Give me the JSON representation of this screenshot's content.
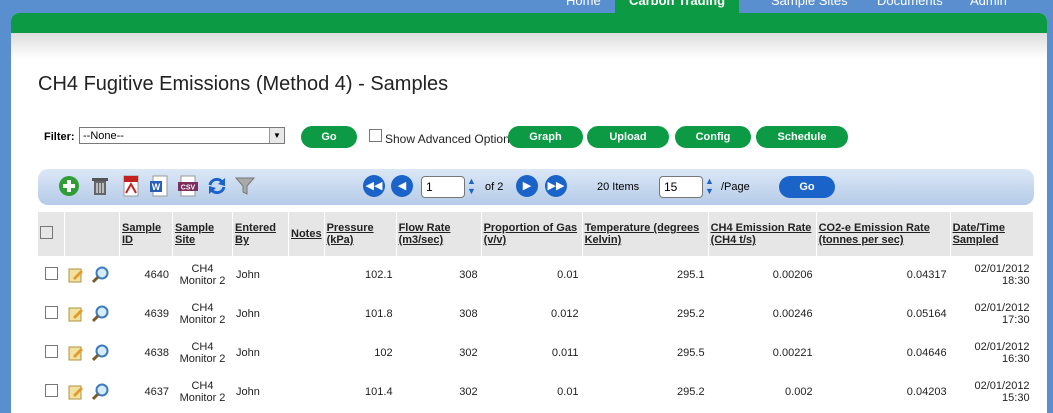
{
  "topnav": {
    "items": [
      "Home",
      "Carbon Trading",
      "Sample Sites",
      "Documents",
      "Admin"
    ],
    "active": "Carbon Trading"
  },
  "page_title": "CH4 Fugitive Emissions (Method 4) - Samples",
  "filter": {
    "label": "Filter:",
    "value": "--None--",
    "go": "Go",
    "show_advanced": "Show Advanced Options"
  },
  "actions": [
    "Graph",
    "Upload",
    "Config",
    "Schedule"
  ],
  "pager": {
    "page": "1",
    "of": "of 2",
    "items": "20 Items",
    "per_page": "15",
    "per_page_label": "/Page",
    "go": "Go"
  },
  "table": {
    "headers": [
      "Sample ID",
      "Sample Site",
      "Entered By",
      "Notes",
      "Pressure (kPa)",
      "Flow Rate (m3/sec)",
      "Proportion of Gas (v/v)",
      "Temperature (degrees Kelvin)",
      "CH4 Emission Rate (CH4 t/s)",
      "CO2-e Emission Rate (tonnes per sec)",
      "Date/Time Sampled"
    ],
    "rows": [
      {
        "id": "4640",
        "site": "CH4 Monitor 2",
        "by": "John",
        "pressure": "102.1",
        "flow": "308",
        "prop": "0.01",
        "temp": "295.1",
        "ch4": "0.00206",
        "co2": "0.04317",
        "dt": "02/01/2012 18:30"
      },
      {
        "id": "4639",
        "site": "CH4 Monitor 2",
        "by": "John",
        "pressure": "101.8",
        "flow": "308",
        "prop": "0.012",
        "temp": "295.2",
        "ch4": "0.00246",
        "co2": "0.05164",
        "dt": "02/01/2012 17:30"
      },
      {
        "id": "4638",
        "site": "CH4 Monitor 2",
        "by": "John",
        "pressure": "102",
        "flow": "302",
        "prop": "0.011",
        "temp": "295.5",
        "ch4": "0.00221",
        "co2": "0.04646",
        "dt": "02/01/2012 16:30"
      },
      {
        "id": "4637",
        "site": "CH4 Monitor 2",
        "by": "John",
        "pressure": "101.4",
        "flow": "302",
        "prop": "0.01",
        "temp": "295.2",
        "ch4": "0.002",
        "co2": "0.04203",
        "dt": "02/01/2012 15:30"
      }
    ]
  },
  "icons": [
    "add-icon",
    "trash-icon",
    "pdf-icon",
    "word-icon",
    "csv-icon",
    "refresh-icon",
    "filter-icon",
    "edit-icon",
    "view-icon"
  ]
}
